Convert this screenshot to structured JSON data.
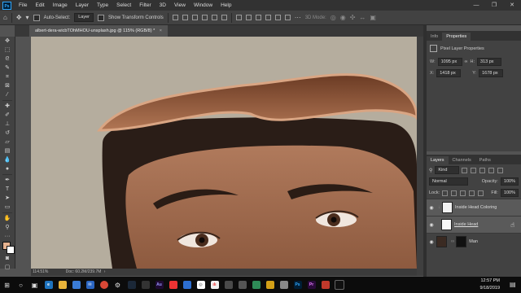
{
  "menu": {
    "logo": "Ps",
    "items": [
      "File",
      "Edit",
      "Image",
      "Layer",
      "Type",
      "Select",
      "Filter",
      "3D",
      "View",
      "Window",
      "Help"
    ]
  },
  "window_controls": {
    "minimize": "—",
    "restore": "❐",
    "close": "✕"
  },
  "options_bar": {
    "auto_select_label": "Auto-Select:",
    "auto_select_value": "Layer",
    "transform_controls_label": "Show Transform Controls",
    "mode_3d_label": "3D Mode:"
  },
  "document": {
    "tab_title": "albert-dera-wicbTOhMHOU-unsplash.jpg @ 115% (RGB/8) *",
    "zoom": "114.51%",
    "doc_info": "Doc: 60.2M/239.7M"
  },
  "properties": {
    "tabs": [
      "Info",
      "Properties"
    ],
    "active_tab": "Properties",
    "section_title": "Pixel Layer Properties",
    "w_label": "W:",
    "w_value": "1095 px",
    "h_label": "H:",
    "h_value": "313 px",
    "x_label": "X:",
    "x_value": "1418 px",
    "y_label": "Y:",
    "y_value": "1678 px",
    "link_icon": "chain-link"
  },
  "layers": {
    "tabs": [
      "Layers",
      "Channels",
      "Paths"
    ],
    "active_tab": "Layers",
    "filter_value": "Kind",
    "blend_mode": "Normal",
    "opacity_label": "Opacity:",
    "opacity_value": "100%",
    "lock_label": "Lock:",
    "fill_label": "Fill:",
    "fill_value": "100%",
    "rows": [
      {
        "name": "Inside Head Coloring",
        "selected": true,
        "thumb": "#f2f2f2"
      },
      {
        "name": "Inside Head",
        "selected": true,
        "thumb": "#f8f8f8"
      },
      {
        "name": "Man",
        "selected": false,
        "thumb": "#3a2a22"
      }
    ]
  },
  "colors": {
    "foreground": "#e6b28f",
    "background": "#ffffff",
    "canvas_bg": "#b5ad9e"
  },
  "taskbar": {
    "time": "12:57 PM",
    "date": "9/18/2019"
  }
}
